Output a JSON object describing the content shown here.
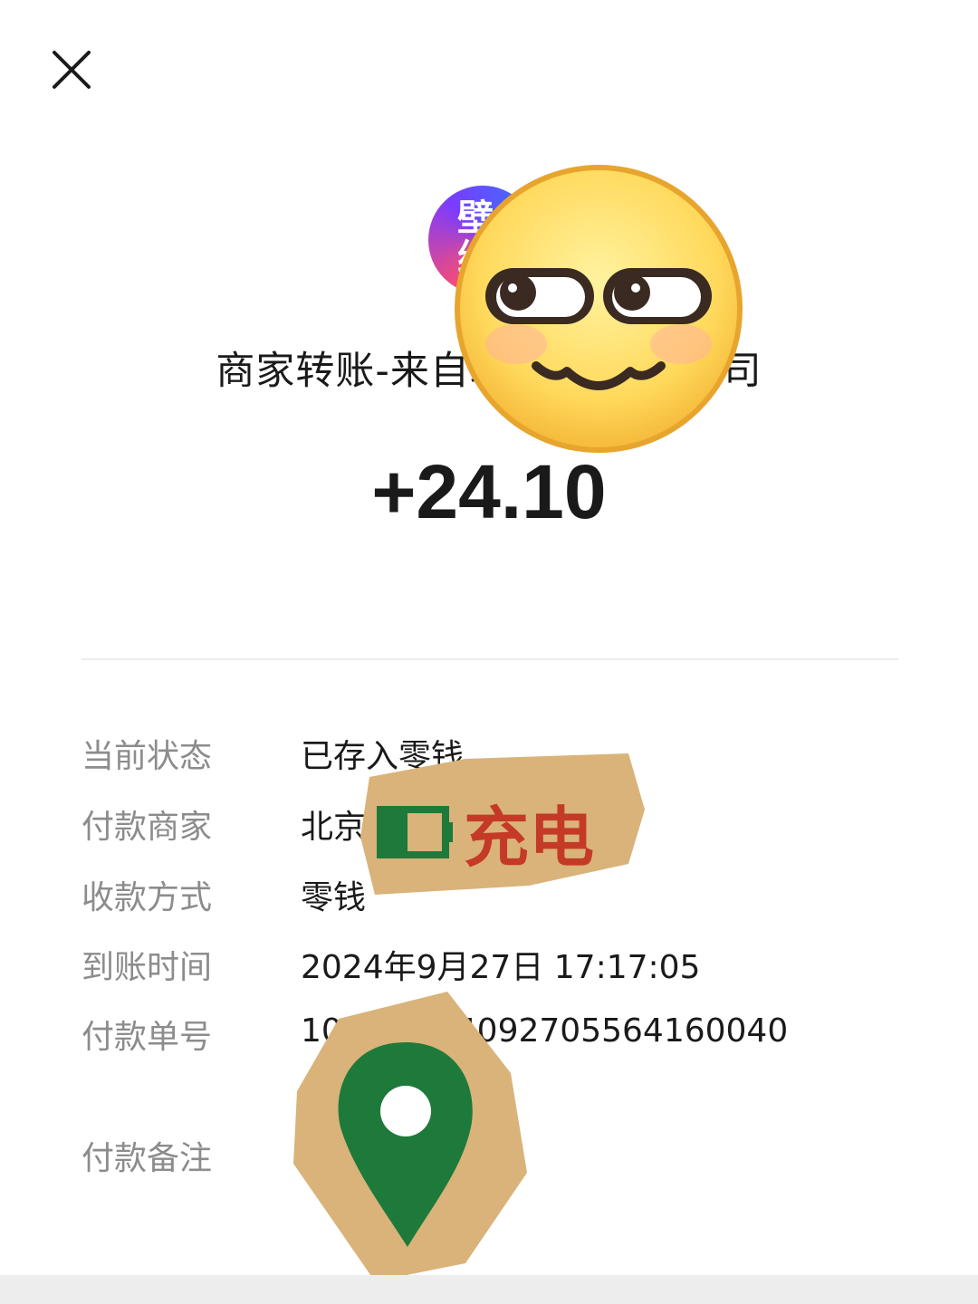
{
  "header": {
    "close_icon": "close-icon"
  },
  "merchant": {
    "logo_text": "壁纸",
    "title": "商家转账-来自北京宝                    有限公司"
  },
  "amount": "+24.10",
  "details": {
    "status": {
      "label": "当前状态",
      "value": "已存入零钱"
    },
    "payer": {
      "label": "付款商家",
      "value": "北京                                  公司"
    },
    "method": {
      "label": "收款方式",
      "value": "零钱"
    },
    "arrival_time": {
      "label": "到账时间",
      "value": "2024年9月27日 17:17:05"
    },
    "order_no": {
      "label": "付款单号",
      "value": "10            553224092705564160040"
    },
    "remark": {
      "label": "付款备注",
      "value": ""
    }
  },
  "stickers": {
    "smiley": "smiley-emoji-sticker",
    "charge_text": "充电",
    "pin": "map-pin-sticker"
  },
  "colors": {
    "text_primary": "#1a1a1a",
    "text_secondary": "#8c8c8c",
    "divider": "#ececec",
    "sticker_green": "#1e7a3a",
    "sticker_red": "#c43a26",
    "sticker_paper": "#d8b37a"
  }
}
